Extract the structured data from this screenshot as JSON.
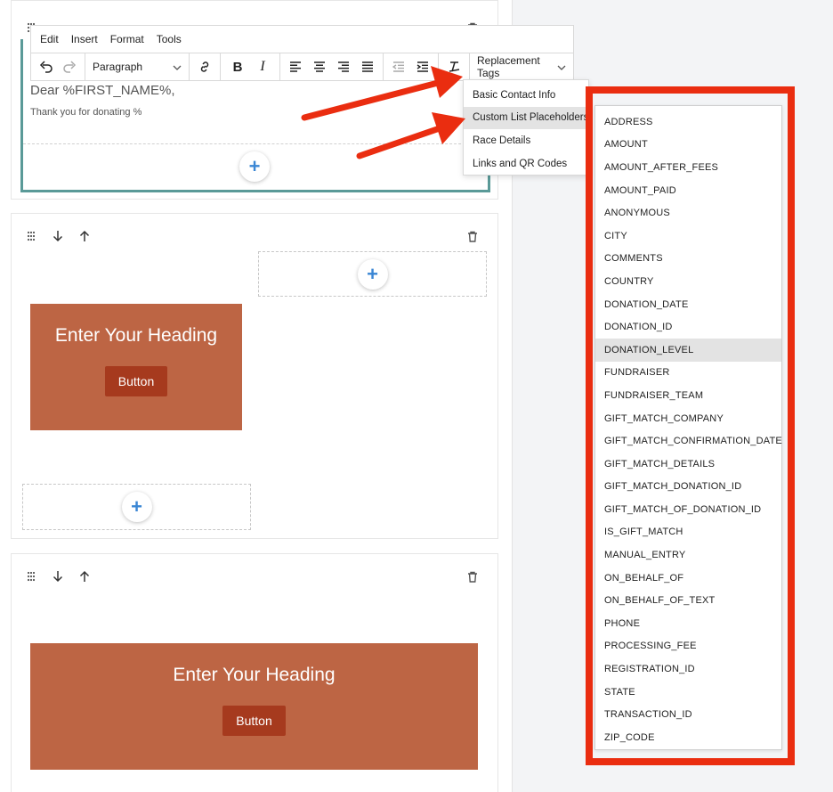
{
  "editor": {
    "menu": [
      "Edit",
      "Insert",
      "Format",
      "Tools"
    ],
    "paragraph_label": "Paragraph",
    "replacement_tags_label": "Replacement Tags",
    "greeting": "Dear %FIRST_NAME%,",
    "body_text": "Thank you for donating %"
  },
  "replacement_menu": {
    "items": [
      "Basic Contact Info",
      "Custom List Placeholders",
      "Race Details",
      "Links and QR Codes"
    ],
    "active_index": 1
  },
  "placeholders": {
    "items": [
      "ADDRESS",
      "AMOUNT",
      "AMOUNT_AFTER_FEES",
      "AMOUNT_PAID",
      "ANONYMOUS",
      "CITY",
      "COMMENTS",
      "COUNTRY",
      "DONATION_DATE",
      "DONATION_ID",
      "DONATION_LEVEL",
      "FUNDRAISER",
      "FUNDRAISER_TEAM",
      "GIFT_MATCH_COMPANY",
      "GIFT_MATCH_CONFIRMATION_DATE",
      "GIFT_MATCH_DETAILS",
      "GIFT_MATCH_DONATION_ID",
      "GIFT_MATCH_OF_DONATION_ID",
      "IS_GIFT_MATCH",
      "MANUAL_ENTRY",
      "ON_BEHALF_OF",
      "ON_BEHALF_OF_TEXT",
      "PHONE",
      "PROCESSING_FEE",
      "REGISTRATION_ID",
      "STATE",
      "TRANSACTION_ID",
      "ZIP_CODE"
    ],
    "active_index": 10
  },
  "hero_1": {
    "heading": "Enter Your Heading",
    "button": "Button"
  },
  "hero_2": {
    "heading": "Enter Your Heading",
    "button": "Button"
  },
  "colors": {
    "hero_bg": "#bd6544",
    "hero_button": "#a63a1e",
    "annotation_red": "#ea2d10",
    "editor_focus": "#5a9a98",
    "plus_blue": "#3a86d4"
  }
}
